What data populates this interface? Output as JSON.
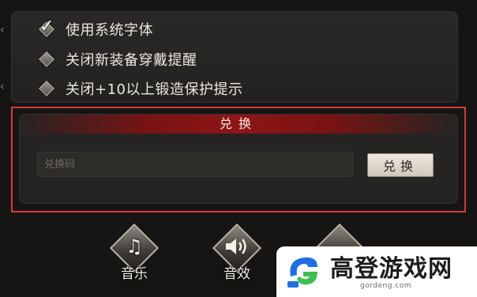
{
  "settings": {
    "options": [
      {
        "label": "使用系统字体",
        "checked": true
      },
      {
        "label": "关闭新装备穿戴提醒",
        "checked": false
      },
      {
        "label": "关闭+10以上锻造保护提示",
        "checked": false
      }
    ]
  },
  "redeem": {
    "title": "兑换",
    "input_placeholder": "兑换码",
    "input_value": "",
    "button_label": "兑换"
  },
  "audio": {
    "music_label": "音乐",
    "sfx_label": "音效"
  },
  "watermark": {
    "site_name": "高登游戏网",
    "url": "gordeng.com"
  },
  "colors": {
    "highlight_border": "#d23b3f",
    "header_red": "#8e1616",
    "logo_blue": "#1f6fe0",
    "logo_green": "#3fbf4f"
  },
  "icons": {
    "checkmark": "check-icon",
    "music": "music-note-icon",
    "sfx": "speaker-icon"
  }
}
